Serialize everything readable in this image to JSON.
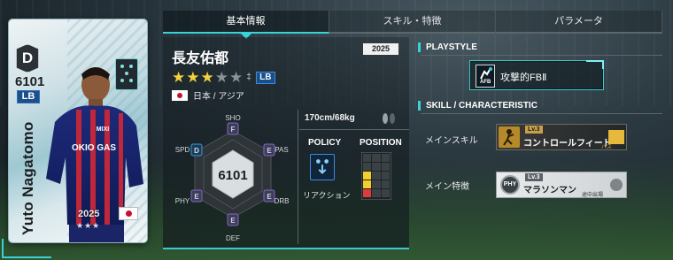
{
  "tabs": [
    {
      "label": "基本情報",
      "active": true
    },
    {
      "label": "スキル・特徴",
      "active": false
    },
    {
      "label": "パラメータ",
      "active": false
    }
  ],
  "card": {
    "rarity": "D",
    "rating": "6101",
    "position": "LB",
    "name": "Yuto Nagatomo",
    "year": "2025",
    "stars": "★★★"
  },
  "player": {
    "name": "長友佑都",
    "season": "2025",
    "stars_filled": 3,
    "stars_total": 5,
    "position": "LB",
    "nation": "日本 / アジア",
    "physique": "170cm/68kg",
    "overall": "6101"
  },
  "hexagon": {
    "labels": {
      "sho": "SHO",
      "pas": "PAS",
      "drb": "DRB",
      "def": "DEF",
      "phy": "PHY",
      "spd": "SPD"
    },
    "grades": {
      "sho": "F",
      "pas": "E",
      "drb": "E",
      "def": "E",
      "phy": "E",
      "spd": "D"
    },
    "colors": {
      "accent": "#38d3d6",
      "grade_d": "#3a9ad6",
      "grade_e": "#8a63c9",
      "grade_f": "#8a63c9"
    }
  },
  "policy": {
    "header": "POLICY",
    "value": "リアクション"
  },
  "position_map": {
    "header": "POSITION"
  },
  "playstyle": {
    "header": "PLAYSTYLE",
    "icon_text": "AFB",
    "value": "攻撃的FBⅡ"
  },
  "skill": {
    "header": "SKILL / CHARACTERISTIC",
    "main_skill_label": "メインスキル",
    "main_skill": {
      "level": "Lv.3",
      "name": "コントロールフィード",
      "sub": "パス"
    },
    "main_trait_label": "メイン特徴",
    "main_trait": {
      "icon_text": "PHY",
      "level": "Lv.3",
      "name": "マラソンマン",
      "sub": "途中出場"
    }
  }
}
